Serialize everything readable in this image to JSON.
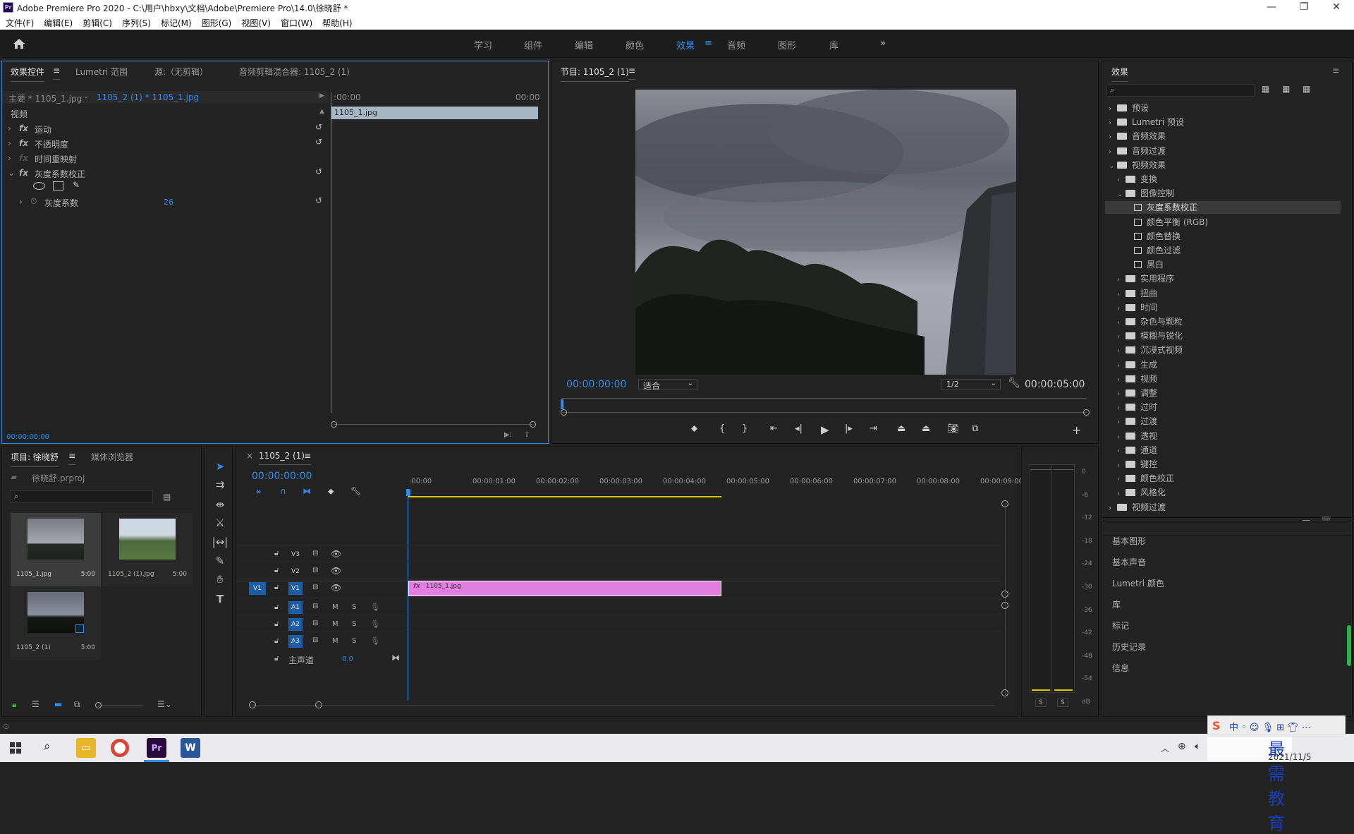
{
  "window": {
    "title": "Adobe Premiere Pro 2020 - C:\\用户\\hbxy\\文档\\Adobe\\Premiere Pro\\14.0\\徐晓舒 *",
    "logo": "Pr"
  },
  "menu": [
    "文件(F)",
    "编辑(E)",
    "剪辑(C)",
    "序列(S)",
    "标记(M)",
    "图形(G)",
    "视图(V)",
    "窗口(W)",
    "帮助(H)"
  ],
  "workspaces": [
    "学习",
    "组件",
    "编辑",
    "颜色",
    "效果",
    "音频",
    "图形",
    "库"
  ],
  "active_workspace": "效果",
  "effect_controls": {
    "tabs": [
      "效果控件",
      "Lumetri 范围",
      "源:（无剪辑）",
      "音频剪辑混合器: 1105_2 (1)"
    ],
    "master": "主要 * 1105_1.jpg",
    "sequence_clip": "1105_2 (1) * 1105_1.jpg",
    "tc_start": ":00:00",
    "tc_end": "00:00",
    "clip_name": "1105_1.jpg",
    "section_video": "视频",
    "items": [
      "运动",
      "不透明度",
      "时间重映射",
      "灰度系数校正"
    ],
    "param_name": "灰度系数",
    "param_value": "26",
    "timecode": "00:00:00:00"
  },
  "program": {
    "tab": "节目: 1105_2 (1)",
    "timecode": "00:00:00:00",
    "fit": "适合",
    "resolution": "1/2",
    "duration": "00:00:05:00"
  },
  "project": {
    "tabs": [
      "项目: 徐晓舒",
      "媒体浏览器"
    ],
    "file": "徐晓舒.prproj",
    "search_placeholder": "",
    "items": [
      {
        "name": "1105_1.jpg",
        "dur": "5:00"
      },
      {
        "name": "1105_2 (1).jpg",
        "dur": "5:00"
      },
      {
        "name": "1105_2 (1)",
        "dur": "5:00"
      }
    ]
  },
  "timeline": {
    "tab": "1105_2 (1)",
    "timecode": "00:00:00:00",
    "ruler": [
      ":00:00",
      "00:00:01:00",
      "00:00:02:00",
      "00:00:03:00",
      "00:00:04:00",
      "00:00:05:00",
      "00:00:06:00",
      "00:00:07:00",
      "00:00:08:00",
      "00:00:09:00"
    ],
    "video_tracks": [
      "V3",
      "V2",
      "V1"
    ],
    "audio_tracks": [
      "A1",
      "A2",
      "A3"
    ],
    "source_patch": "V1",
    "master": "主声道",
    "master_value": "0.0",
    "clip": "1105_1.jpg",
    "clip_color": "#e17ee0",
    "m": "M",
    "s": "S"
  },
  "meter": {
    "labels": [
      "0",
      "-6",
      "-12",
      "-18",
      "-24",
      "-30",
      "-36",
      "-42",
      "-48",
      "-54",
      "dB"
    ],
    "solo": [
      "S",
      "S"
    ]
  },
  "effects_panel": {
    "title": "效果",
    "tree": [
      {
        "label": "预设",
        "level": 0,
        "type": "folder",
        "open": false
      },
      {
        "label": "Lumetri 预设",
        "level": 0,
        "type": "folder",
        "open": false
      },
      {
        "label": "音频效果",
        "level": 0,
        "type": "folder",
        "open": false
      },
      {
        "label": "音频过渡",
        "level": 0,
        "type": "folder",
        "open": false
      },
      {
        "label": "视频效果",
        "level": 0,
        "type": "folder",
        "open": true
      },
      {
        "label": "变换",
        "level": 1,
        "type": "folder",
        "open": false
      },
      {
        "label": "图像控制",
        "level": 1,
        "type": "folder",
        "open": true
      },
      {
        "label": "灰度系数校正",
        "level": 2,
        "type": "effect",
        "selected": true
      },
      {
        "label": "颜色平衡 (RGB)",
        "level": 2,
        "type": "effect"
      },
      {
        "label": "颜色替换",
        "level": 2,
        "type": "effect"
      },
      {
        "label": "颜色过滤",
        "level": 2,
        "type": "effect"
      },
      {
        "label": "黑白",
        "level": 2,
        "type": "effect"
      },
      {
        "label": "实用程序",
        "level": 1,
        "type": "folder",
        "open": false
      },
      {
        "label": "扭曲",
        "level": 1,
        "type": "folder",
        "open": false
      },
      {
        "label": "时间",
        "level": 1,
        "type": "folder",
        "open": false
      },
      {
        "label": "杂色与颗粒",
        "level": 1,
        "type": "folder",
        "open": false
      },
      {
        "label": "模糊与锐化",
        "level": 1,
        "type": "folder",
        "open": false
      },
      {
        "label": "沉浸式视频",
        "level": 1,
        "type": "folder",
        "open": false
      },
      {
        "label": "生成",
        "level": 1,
        "type": "folder",
        "open": false
      },
      {
        "label": "视频",
        "level": 1,
        "type": "folder",
        "open": false
      },
      {
        "label": "调整",
        "level": 1,
        "type": "folder",
        "open": false
      },
      {
        "label": "过时",
        "level": 1,
        "type": "folder",
        "open": false
      },
      {
        "label": "过渡",
        "level": 1,
        "type": "folder",
        "open": false
      },
      {
        "label": "透视",
        "level": 1,
        "type": "folder",
        "open": false
      },
      {
        "label": "通道",
        "level": 1,
        "type": "folder",
        "open": false
      },
      {
        "label": "键控",
        "level": 1,
        "type": "folder",
        "open": false
      },
      {
        "label": "颜色校正",
        "level": 1,
        "type": "folder",
        "open": false
      },
      {
        "label": "风格化",
        "level": 1,
        "type": "folder",
        "open": false
      },
      {
        "label": "视频过渡",
        "level": 0,
        "type": "folder",
        "open": false
      }
    ],
    "side_panels": [
      "基本图形",
      "基本声音",
      "Lumetri 颜色",
      "库",
      "标记",
      "历史记录",
      "信息"
    ]
  },
  "taskbar": {
    "date": "2021/11/5",
    "watermark": "最需教育"
  },
  "colors": {
    "accent": "#2d8ceb",
    "clip": "#e17ee0",
    "panel": "#232323"
  }
}
